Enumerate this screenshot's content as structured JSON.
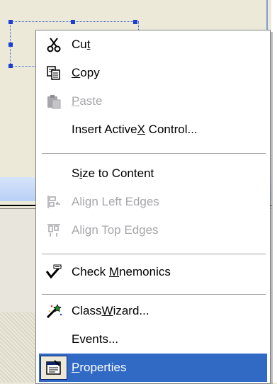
{
  "menu": {
    "items": [
      {
        "name": "cut",
        "pre": "Cu",
        "ul": "t",
        "post": "",
        "icon": "scissors-icon",
        "disabled": false,
        "selected": false
      },
      {
        "name": "copy",
        "pre": "",
        "ul": "C",
        "post": "opy",
        "icon": "copy-icon",
        "disabled": false,
        "selected": false
      },
      {
        "name": "paste",
        "pre": "",
        "ul": "P",
        "post": "aste",
        "icon": "paste-icon",
        "disabled": true,
        "selected": false
      },
      {
        "name": "insert-activex-control",
        "pre": "Insert Active",
        "ul": "X",
        "post": " Control...",
        "icon": "",
        "disabled": false,
        "selected": false
      },
      {
        "name": "size-to-content",
        "pre": "S",
        "ul": "i",
        "post": "ze to Content",
        "icon": "",
        "disabled": false,
        "selected": false
      },
      {
        "name": "align-left-edges",
        "pre": "Align Left Edges",
        "ul": "",
        "post": "",
        "icon": "align-left-icon",
        "disabled": true,
        "selected": false
      },
      {
        "name": "align-top-edges",
        "pre": "Align Top Edges",
        "ul": "",
        "post": "",
        "icon": "align-top-icon",
        "disabled": true,
        "selected": false
      },
      {
        "name": "check-mnemonics",
        "pre": "Check ",
        "ul": "M",
        "post": "nemonics",
        "icon": "checkmark-icon",
        "disabled": false,
        "selected": false
      },
      {
        "name": "classwizard",
        "pre": "Class",
        "ul": "W",
        "post": "izard...",
        "icon": "wizard-wand-icon",
        "disabled": false,
        "selected": false
      },
      {
        "name": "events",
        "pre": "Events...",
        "ul": "",
        "post": "",
        "icon": "",
        "disabled": false,
        "selected": false
      },
      {
        "name": "properties",
        "pre": "",
        "ul": "P",
        "post": "roperties",
        "icon": "properties-icon",
        "disabled": false,
        "selected": true
      }
    ]
  },
  "colors": {
    "highlight": "#316ac5",
    "disabled_text": "#a7a6aa",
    "menu_bg": "#ffffff"
  }
}
